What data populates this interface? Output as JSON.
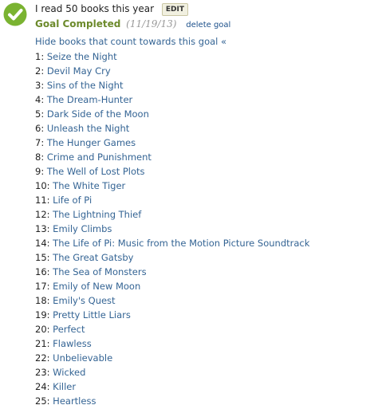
{
  "goal": {
    "title": "I read 50 books this year",
    "edit_label": "EDIT",
    "status_label": "Goal Completed",
    "status_date": "(11/19/13)",
    "delete_label": "delete goal",
    "hide_books_label": "Hide books that count towards this goal «",
    "check_icon": "check-circle-icon",
    "colors": {
      "check": "#7ab331",
      "status": "#6c8a2b",
      "link": "#346494"
    }
  },
  "books": [
    {
      "num": "1:",
      "title": "Seize the Night"
    },
    {
      "num": "2:",
      "title": "Devil May Cry"
    },
    {
      "num": "3:",
      "title": "Sins of the Night"
    },
    {
      "num": "4:",
      "title": "The Dream-Hunter"
    },
    {
      "num": "5:",
      "title": "Dark Side of the Moon"
    },
    {
      "num": "6:",
      "title": "Unleash the Night"
    },
    {
      "num": "7:",
      "title": "The Hunger Games"
    },
    {
      "num": "8:",
      "title": "Crime and Punishment"
    },
    {
      "num": "9:",
      "title": "The Well of Lost Plots"
    },
    {
      "num": "10:",
      "title": "The White Tiger"
    },
    {
      "num": "11:",
      "title": "Life of Pi"
    },
    {
      "num": "12:",
      "title": "The Lightning Thief"
    },
    {
      "num": "13:",
      "title": "Emily Climbs"
    },
    {
      "num": "14:",
      "title": "The Life of Pi: Music from the Motion Picture Soundtrack"
    },
    {
      "num": "15:",
      "title": "The Great Gatsby"
    },
    {
      "num": "16:",
      "title": "The Sea of Monsters"
    },
    {
      "num": "17:",
      "title": "Emily of New Moon"
    },
    {
      "num": "18:",
      "title": "Emily's Quest"
    },
    {
      "num": "19:",
      "title": "Pretty Little Liars"
    },
    {
      "num": "20:",
      "title": "Perfect"
    },
    {
      "num": "21:",
      "title": "Flawless"
    },
    {
      "num": "22:",
      "title": "Unbelievable"
    },
    {
      "num": "23:",
      "title": "Wicked"
    },
    {
      "num": "24:",
      "title": "Killer"
    },
    {
      "num": "25:",
      "title": "Heartless"
    }
  ]
}
